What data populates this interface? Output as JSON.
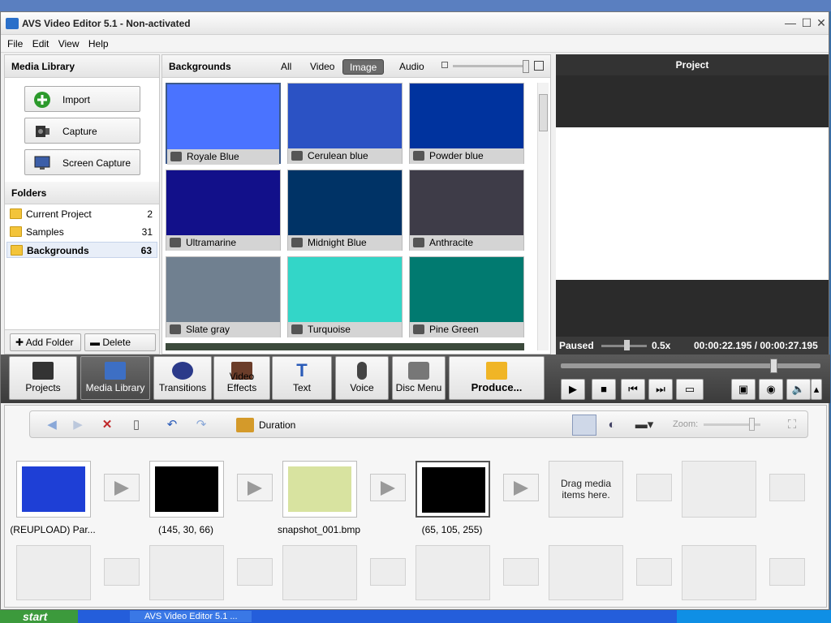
{
  "window": {
    "title": "AVS Video Editor 5.1 - Non-activated",
    "minimize": "—",
    "maximize": "☐",
    "close": "✕"
  },
  "menu": [
    "File",
    "Edit",
    "View",
    "Help"
  ],
  "media_library": {
    "title": "Media Library",
    "buttons": [
      "Import",
      "Capture",
      "Screen Capture"
    ],
    "folders_title": "Folders",
    "folders": [
      {
        "name": "Current Project",
        "count": "2"
      },
      {
        "name": "Samples",
        "count": "31"
      },
      {
        "name": "Backgrounds",
        "count": "63"
      }
    ],
    "add_folder": "Add Folder",
    "delete_folder": "Delete Folder"
  },
  "backgrounds": {
    "title": "Backgrounds",
    "filters": [
      "All",
      "Video",
      "Image",
      "Audio"
    ],
    "active_filter": "Image",
    "tiles": [
      {
        "name": "Royale Blue",
        "color": "#4a73ff"
      },
      {
        "name": "Cerulean blue",
        "color": "#2b52c4"
      },
      {
        "name": "Powder blue",
        "color": "#00339e"
      },
      {
        "name": "Ultramarine",
        "color": "#12108a"
      },
      {
        "name": "Midnight Blue",
        "color": "#003366"
      },
      {
        "name": "Anthracite",
        "color": "#3e3c48"
      },
      {
        "name": "Slate gray",
        "color": "#708090"
      },
      {
        "name": "Turquoise",
        "color": "#33d6c8"
      },
      {
        "name": "Pine Green",
        "color": "#017a70"
      }
    ]
  },
  "preview": {
    "title": "Project",
    "state": "Paused",
    "speed": "0.5x",
    "time": "00:00:22.195 / 00:00:27.195"
  },
  "tabs": [
    "Projects",
    "Media Library",
    "Transitions",
    "Video Effects",
    "Text",
    "Voice",
    "Disc Menu",
    "Produce..."
  ],
  "active_tab": "Media Library",
  "controls": [
    "▶",
    "■",
    "⏮",
    "⏭",
    "▭"
  ],
  "timeline": {
    "duration_label": "Duration",
    "zoom_label": "Zoom:",
    "clips": [
      {
        "label": "(REUPLOAD) Par...",
        "color": "#1e3fd6"
      },
      {
        "label": "(145, 30, 66)",
        "color": "#000000"
      },
      {
        "label": "snapshot_001.bmp",
        "color": "#d8e3a0"
      },
      {
        "label": "(65, 105, 255)",
        "color": "#000000"
      }
    ],
    "drop_text": "Drag media items here."
  },
  "taskbar": {
    "start": "start",
    "task": "AVS Video Editor 5.1 ..."
  }
}
